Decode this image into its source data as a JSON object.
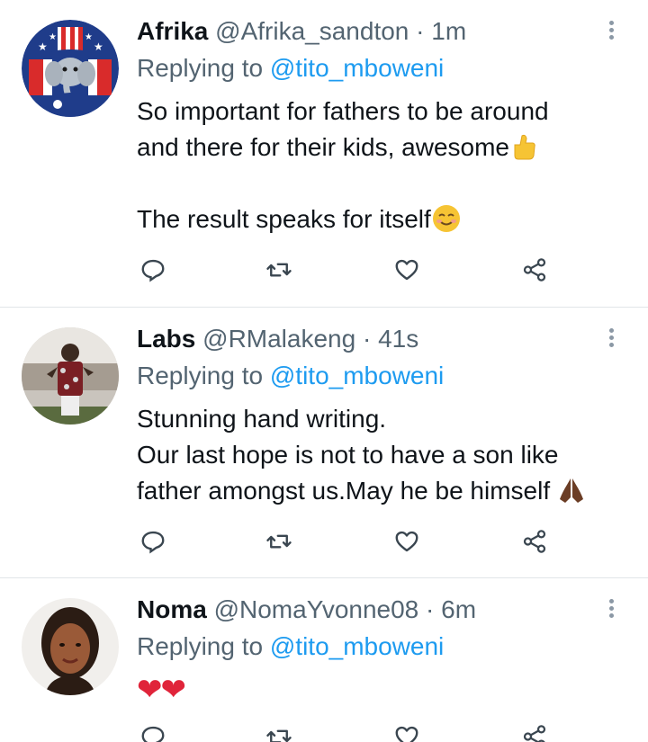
{
  "tweets": [
    {
      "name": "Afrika",
      "handle": "@Afrika_sandton",
      "time": "· 1m",
      "replying_prefix": "Replying to",
      "replying_to": "@tito_mboweni",
      "lines": [
        "So important for fathers to be around",
        "and there for their kids, awesome",
        "",
        "The result speaks for itself"
      ],
      "avatar_icon": "elephant-uncle-sam-avatar"
    },
    {
      "name": "Labs",
      "handle": "@RMalakeng",
      "time": "· 41s",
      "replying_prefix": "Replying to",
      "replying_to": "@tito_mboweni",
      "lines": [
        "Stunning hand writing.",
        "Our last hope is not to have a son like",
        "father amongst us.May he be himself"
      ],
      "avatar_icon": "person-photo-avatar"
    },
    {
      "name": "Noma",
      "handle": "@NomaYvonne08",
      "time": "· 6m",
      "replying_prefix": "Replying to",
      "replying_to": "@tito_mboweni",
      "lines": [],
      "emoji": "❤❤",
      "avatar_icon": "person-photo-avatar"
    }
  ],
  "icons": {
    "reply": "reply-icon",
    "retweet": "retweet-icon",
    "like": "like-icon",
    "share": "share-icon",
    "more": "more-options-icon"
  },
  "colors": {
    "link": "#1d9bf0",
    "secondary_text": "#536471",
    "heart_emoji": "#e0243a"
  }
}
